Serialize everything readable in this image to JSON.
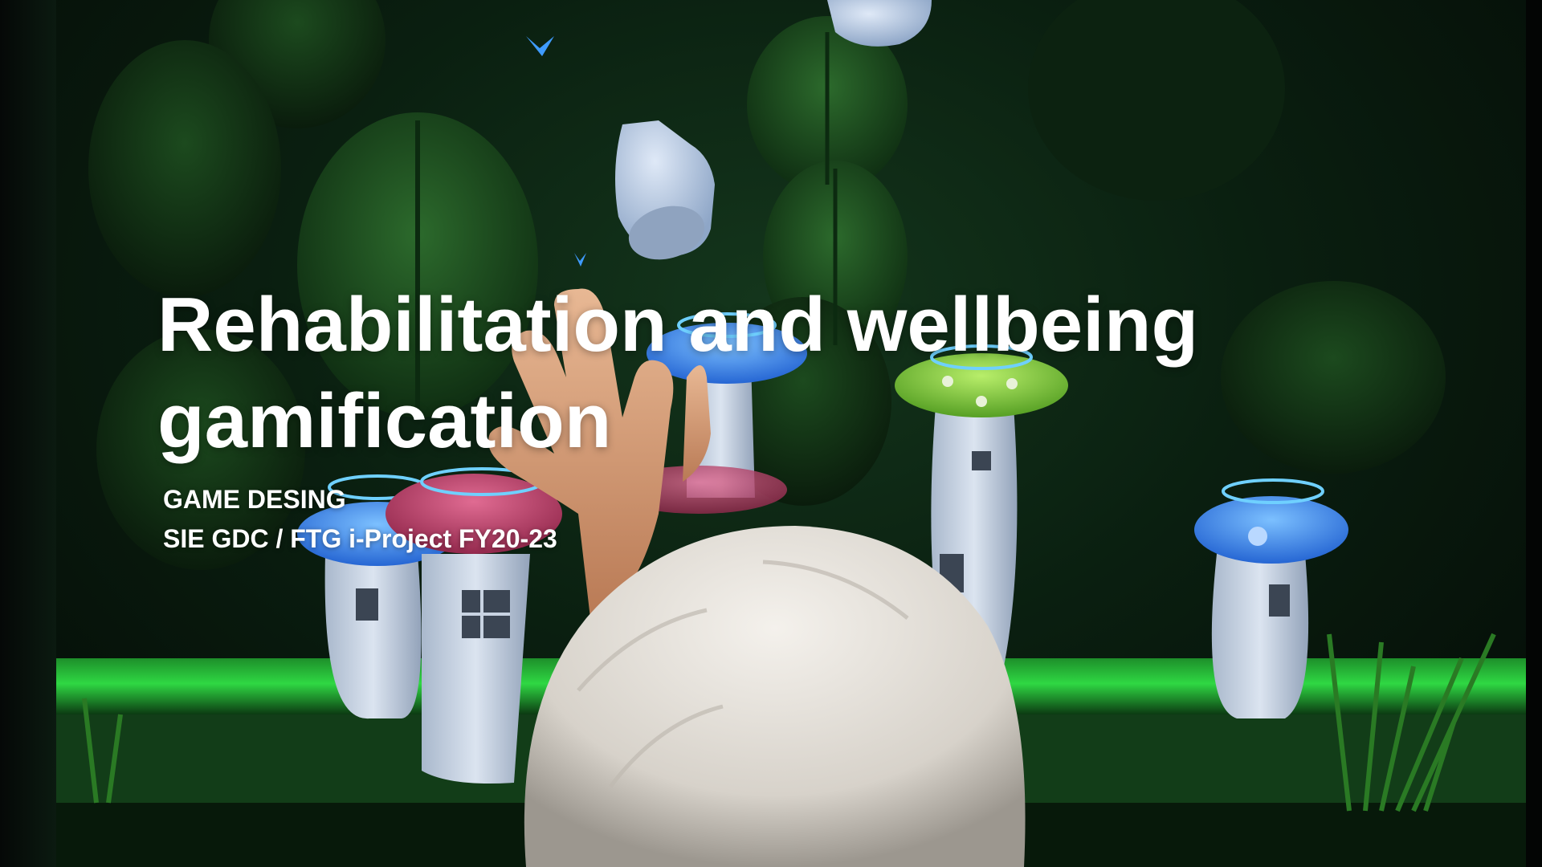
{
  "slide": {
    "title_line_1": "Rehabilitation and wellbeing",
    "title_line_2": "gamification",
    "category": "GAME DESING",
    "project": "SIE GDC / FTG i-Project FY20-23"
  },
  "photo": {
    "subject": "player-reaching-toward-game-screen",
    "elements": [
      "leaf-icon",
      "mushroom-house-icon",
      "glove-icon",
      "butterfly-icon",
      "hand-icon",
      "head-icon",
      "grass-icon"
    ]
  },
  "colors": {
    "text": "#ffffff",
    "foliage_dark": "#0f2a14",
    "foliage_mid": "#1f4a22",
    "glow_green": "#27c23a",
    "mushroom_blue": "#3f8ef0",
    "mushroom_green": "#86d43a",
    "mushroom_pink": "#c2456e",
    "stem": "#c9d5e6",
    "hair": "#e8e4de",
    "skin": "#d9a27c"
  }
}
